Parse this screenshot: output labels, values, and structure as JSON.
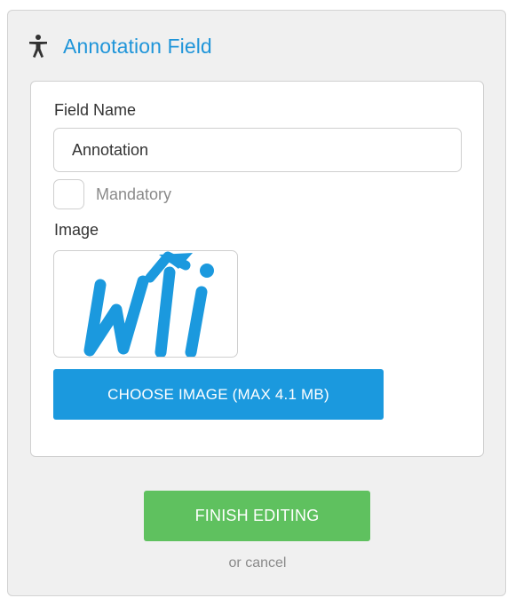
{
  "panel": {
    "title": "Annotation Field",
    "title_icon": "accessibility-person-icon",
    "accent_color": "#1f95d9"
  },
  "form": {
    "field_name_label": "Field Name",
    "field_name_value": "Annotation",
    "mandatory_label": "Mandatory",
    "mandatory_checked": false,
    "image_label": "Image",
    "image_logo_text": "WII",
    "choose_image_label": "CHOOSE IMAGE (MAX 4.1 MB)",
    "choose_button_color": "#1b99de"
  },
  "footer": {
    "finish_label": "FINISH EDITING",
    "finish_button_color": "#5fc15f",
    "cancel_label": "or cancel"
  }
}
